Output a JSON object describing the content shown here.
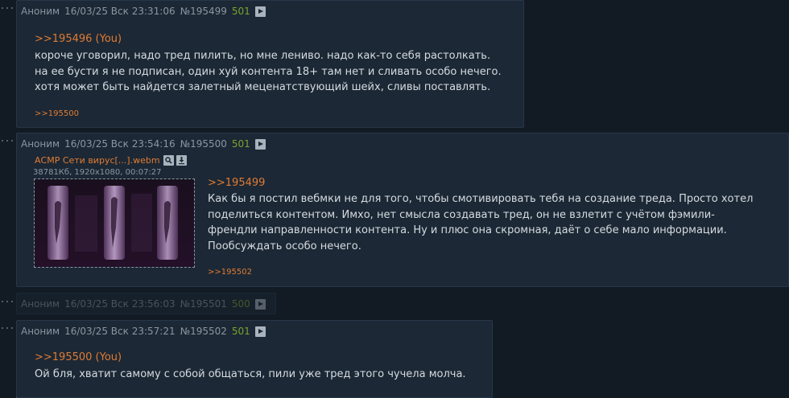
{
  "posts": [
    {
      "author": "Аноним",
      "date": "16/03/25 Вск 23:31:06",
      "num": "№195499",
      "count": "501",
      "quote": ">>195496 (You)",
      "text": "короче уговорил, надо тред пилить, но мне лениво. надо как-то себя растолкать.\nна ее бусти я не подписан, один хуй контента 18+ там нет и сливать особо нечего.\nхотя может быть найдется залетный меценатствующий шейх, сливы поставлять.",
      "replies": ">>195500"
    },
    {
      "author": "Аноним",
      "date": "16/03/25 Вск 23:54:16",
      "num": "№195500",
      "count": "501",
      "file_name": "АСМР Сети вирус[...].webm",
      "file_meta": "38781Кб, 1920x1080, 00:07:27",
      "quote": ">>195499",
      "text": "Как бы я постил вебмки не для того, чтобы смотивировать тебя на создание треда. Просто хотел\nподелиться контентом. Имхо, нет смысла создавать тред, он не взлетит с учётом фэмили-\nфрендли направленности контента. Ну и плюс она скромная, даёт о себе мало информации.\nПообсуждать особо нечего.",
      "replies": ">>195502"
    },
    {
      "author": "Аноним",
      "date": "16/03/25 Вск 23:56:03",
      "num": "№195501",
      "count": "500"
    },
    {
      "author": "Аноним",
      "date": "16/03/25 Вск 23:57:21",
      "num": "№195502",
      "count": "501",
      "quote": ">>195500 (You)",
      "text": "Ой бля, хватит самому с собой общаться, пили уже тред этого чучела молча."
    }
  ],
  "icons": {
    "play": "play-icon",
    "search": "search-icon",
    "download": "download-icon"
  },
  "colors": {
    "background": "#121b24",
    "post_bg": "#1c2835",
    "link": "#e07b34",
    "counter": "#7aa32e",
    "meta": "#8b96a2"
  }
}
